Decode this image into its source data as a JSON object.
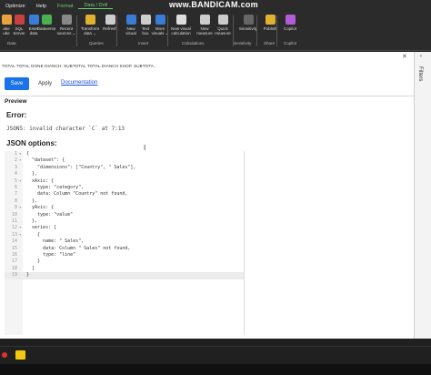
{
  "watermark": "www.BANDICAM.com",
  "menu": [
    "Optimize",
    "Help",
    "Format",
    "Data / Drill"
  ],
  "ribbon": {
    "buttons": [
      {
        "label": "ake\nube",
        "color": "#e8a33d",
        "icon": "table-icon"
      },
      {
        "label": "SQL\nServer",
        "color": "#c94040",
        "icon": "sql-server-icon"
      },
      {
        "label": "Enter\ndata",
        "color": "#3a7bd5",
        "icon": "enter-data-icon"
      },
      {
        "label": "Dataverse",
        "color": "#4caf50",
        "icon": "dataverse-icon"
      },
      {
        "label": "Recent\nsources ⌄",
        "color": "#888888",
        "icon": "recent-sources-icon"
      },
      {
        "label": "Transform\ndata ⌄",
        "color": "#e0b030",
        "icon": "transform-data-icon"
      },
      {
        "label": "Refresh",
        "color": "#cccccc",
        "icon": "refresh-icon"
      },
      {
        "label": "New\nvisual",
        "color": "#3a7bd5",
        "icon": "new-visual-icon"
      },
      {
        "label": "Text\nbox",
        "color": "#cccccc",
        "icon": "text-box-icon"
      },
      {
        "label": "More\nvisuals ⌄",
        "color": "#3a7bd5",
        "icon": "more-visuals-icon"
      },
      {
        "label": "New visual\ncalculation",
        "color": "#dddddd",
        "icon": "visual-calculation-icon"
      },
      {
        "label": "New\nmeasure",
        "color": "#cccccc",
        "icon": "new-measure-icon"
      },
      {
        "label": "Quick\nmeasure",
        "color": "#cccccc",
        "icon": "quick-measure-icon"
      },
      {
        "label": "Sensitivity",
        "color": "#666666",
        "icon": "sensitivity-icon"
      },
      {
        "label": "Publish",
        "color": "#e0b030",
        "icon": "publish-icon"
      },
      {
        "label": "Copilot",
        "color": "#b05cd6",
        "icon": "copilot-icon"
      }
    ],
    "groups": [
      "Data",
      "Queries",
      "Insert",
      "Calculations",
      "Sensitivity",
      "Share",
      "Copilot"
    ]
  },
  "panel": {
    "header_columns": "TOTAL TOTAL DONE DIANCH. SUBTOTAL TOTAL DIANCH SHOP. SUBTOTA..",
    "save_label": "Save",
    "apply_label": "Apply",
    "documentation_label": "Documentation",
    "preview_label": "Preview",
    "error_title": "Error:",
    "error_message": "JSON5: invalid character `C` at 7:13",
    "json_options_title": "JSON options:",
    "filters_label": "Filters",
    "code_lines": [
      {
        "n": "1",
        "fold": "▾",
        "text": "{"
      },
      {
        "n": "2",
        "fold": "▾",
        "text": "  \"dataset\": {"
      },
      {
        "n": "3",
        "fold": "",
        "text": "    \"dimensions\": [\"Country\", \" Sales\"],"
      },
      {
        "n": "4",
        "fold": "",
        "text": "  },"
      },
      {
        "n": "5",
        "fold": "▾",
        "text": "  xAxis: {"
      },
      {
        "n": "6",
        "fold": "",
        "text": "    type: \"category\","
      },
      {
        "n": "7",
        "fold": "",
        "text": "    data: Column \"Country\" not found,"
      },
      {
        "n": "8",
        "fold": "",
        "text": "  },"
      },
      {
        "n": "9",
        "fold": "▾",
        "text": "  yAxis: {"
      },
      {
        "n": "10",
        "fold": "",
        "text": "    type: \"value\""
      },
      {
        "n": "11",
        "fold": "",
        "text": "  },"
      },
      {
        "n": "12",
        "fold": "▾",
        "text": "  series: ["
      },
      {
        "n": "13",
        "fold": "▾",
        "text": "    {"
      },
      {
        "n": "14",
        "fold": "",
        "text": "      name: \" Sales\","
      },
      {
        "n": "15",
        "fold": "",
        "text": "      data: Column \" Sales\" not found,"
      },
      {
        "n": "16",
        "fold": "",
        "text": "      type: \"line\""
      },
      {
        "n": "17",
        "fold": "",
        "text": "    }"
      },
      {
        "n": "18",
        "fold": "",
        "text": "  ]"
      },
      {
        "n": "19",
        "fold": "",
        "text": "}"
      }
    ],
    "active_line": 19
  }
}
